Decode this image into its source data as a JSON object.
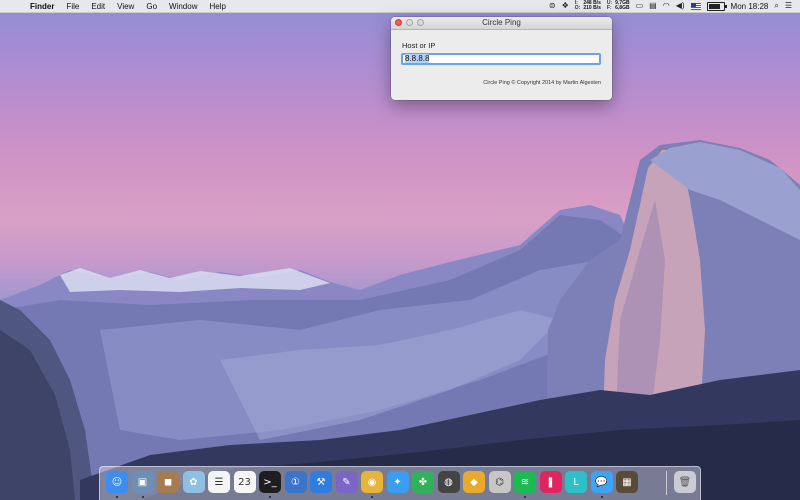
{
  "menubar": {
    "apple_icon": "apple-logo-icon",
    "app_name": "Finder",
    "items": [
      "File",
      "Edit",
      "View",
      "Go",
      "Window",
      "Help"
    ],
    "net_stats": {
      "in_label": "I:",
      "in_value": "248 B/s",
      "out_label": "O:",
      "out_value": "210 B/s",
      "up_label": "U:",
      "up_value": "9,7GB",
      "free_label": "F:",
      "free_value": "6,8GB"
    },
    "clock": "Mon 18:28",
    "status_icons": [
      "sync-icon",
      "dropbox-icon",
      "network-stats",
      "monitor-icon",
      "display-icon",
      "wifi-icon",
      "volume-icon",
      "us-flag-icon",
      "battery-icon",
      "search-icon",
      "notification-center-icon"
    ],
    "battery_level_percent": 85
  },
  "window": {
    "title": "Circle Ping",
    "field_label": "Host or IP",
    "host_value": "8.8.8.8",
    "copyright": "Circle Ping © Copyright 2014 by Martin Algesten",
    "close_color": "#fc5753"
  },
  "dock": {
    "apps": [
      {
        "name": "finder",
        "icon": "finder-icon",
        "glyph": "☺",
        "color": "#3b8df0",
        "running": true
      },
      {
        "name": "preview",
        "icon": "preview-icon",
        "glyph": "▣",
        "color": "#6e8fb5",
        "running": true
      },
      {
        "name": "contacts",
        "icon": "contacts-icon",
        "glyph": "◼",
        "color": "#a67b4f",
        "running": false
      },
      {
        "name": "photos",
        "icon": "photos-icon",
        "glyph": "✿",
        "color": "#8fbfe3",
        "running": false
      },
      {
        "name": "reminders",
        "icon": "reminders-icon",
        "glyph": "☰",
        "color": "#f4f4f4",
        "running": false
      },
      {
        "name": "calendar",
        "icon": "calendar-icon",
        "glyph": "23",
        "color": "#f7f7f7",
        "running": false
      },
      {
        "name": "terminal",
        "icon": "terminal-icon",
        "glyph": ">_",
        "color": "#1e1e1e",
        "running": true
      },
      {
        "name": "1password",
        "icon": "1password-icon",
        "glyph": "①",
        "color": "#3c74c8",
        "running": false
      },
      {
        "name": "xcode",
        "icon": "xcode-icon",
        "glyph": "⚒",
        "color": "#2f7de1",
        "running": false
      },
      {
        "name": "scrivener",
        "icon": "pen-icon",
        "glyph": "✎",
        "color": "#7b65c7",
        "running": false
      },
      {
        "name": "chrome",
        "icon": "chrome-icon",
        "glyph": "◉",
        "color": "#e6b33b",
        "running": true
      },
      {
        "name": "safari",
        "icon": "safari-icon",
        "glyph": "✦",
        "color": "#3a9ded",
        "running": false
      },
      {
        "name": "sourcetree",
        "icon": "network-graph-icon",
        "glyph": "✤",
        "color": "#2fb25a",
        "running": false
      },
      {
        "name": "disk-utility",
        "icon": "disk-utility-icon",
        "glyph": "◍",
        "color": "#444444",
        "running": false
      },
      {
        "name": "sketch",
        "icon": "sketch-icon",
        "glyph": "◆",
        "color": "#e8a92c",
        "running": false
      },
      {
        "name": "network-radar",
        "icon": "radar-icon",
        "glyph": "⌬",
        "color": "#c7c7c7",
        "running": false
      },
      {
        "name": "spotify",
        "icon": "spotify-icon",
        "glyph": "≋",
        "color": "#1db954",
        "running": true
      },
      {
        "name": "kaleidoscope",
        "icon": "kaleidoscope-icon",
        "glyph": "❚",
        "color": "#e0245e",
        "running": false
      },
      {
        "name": "lexi",
        "icon": "l-icon",
        "glyph": "L",
        "color": "#2cc1c9",
        "running": false
      },
      {
        "name": "messages",
        "icon": "messages-icon",
        "glyph": "💬",
        "color": "#3ea3f5",
        "running": true
      },
      {
        "name": "photo-booth",
        "icon": "photo-booth-icon",
        "glyph": "▦",
        "color": "#5a4a3a",
        "running": false
      }
    ],
    "trash": {
      "name": "trash",
      "icon": "trash-icon",
      "glyph": "🗑",
      "color": "#c9cdd3"
    }
  }
}
